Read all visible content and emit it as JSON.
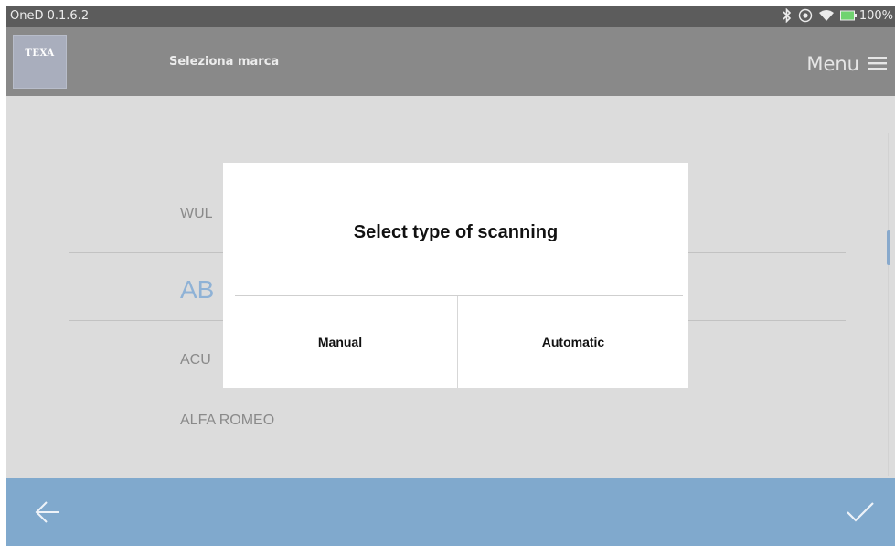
{
  "status_bar": {
    "app_version": "OneD 0.1.6.2",
    "battery": "100%",
    "icons": [
      "bluetooth-icon",
      "location-icon",
      "wifi-icon",
      "battery-icon"
    ]
  },
  "header": {
    "logo": "TEXA",
    "title": "Seleziona marca",
    "menu_label": "Menu",
    "menu_icon": "hamburger-icon"
  },
  "brand_list": {
    "items": [
      "WUL",
      "AB",
      "ACU",
      "ALFA ROMEO"
    ],
    "selected_index": 1
  },
  "dialog": {
    "title": "Select type of scanning",
    "options": [
      "Manual",
      "Automatic"
    ]
  },
  "bottom_bar": {
    "back_icon": "arrow-left-icon",
    "confirm_icon": "checkmark-icon"
  },
  "colors": {
    "header_bg": "#898989",
    "status_bg": "#5c5c5c",
    "content_bg": "#dcdcdc",
    "accent": "#80a9cd",
    "selected_text": "#8fb2d6"
  }
}
